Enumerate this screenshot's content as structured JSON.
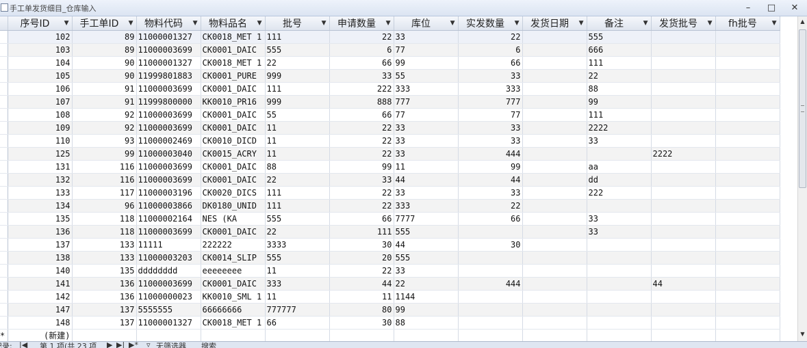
{
  "window": {
    "title": "手工单发货细目_仓库输入"
  },
  "columns": [
    {
      "label": "序号ID",
      "align": "num"
    },
    {
      "label": "手工单ID",
      "align": "num"
    },
    {
      "label": "物料代码",
      "align": "txt"
    },
    {
      "label": "物料品名",
      "align": "txt"
    },
    {
      "label": "批号",
      "align": "txt"
    },
    {
      "label": "申请数量",
      "align": "num"
    },
    {
      "label": "库位",
      "align": "txt"
    },
    {
      "label": "实发数量",
      "align": "num"
    },
    {
      "label": "发货日期",
      "align": "txt"
    },
    {
      "label": "备注",
      "align": "txt"
    },
    {
      "label": "发货批号",
      "align": "txt"
    },
    {
      "label": "fh批号",
      "align": "txt"
    }
  ],
  "rows": [
    [
      "102",
      "89",
      "11000001327",
      "CK0018_MET 1",
      "111",
      "22",
      "33",
      "22",
      "",
      "555",
      "",
      ""
    ],
    [
      "103",
      "89",
      "11000003699",
      "CK0001_DAIC",
      "555",
      "6",
      "77",
      "6",
      "",
      "666",
      "",
      ""
    ],
    [
      "104",
      "90",
      "11000001327",
      "CK0018_MET 1",
      "22",
      "66",
      "99",
      "66",
      "",
      "111",
      "",
      ""
    ],
    [
      "105",
      "90",
      "11999801883",
      "CK0001_PURE",
      "999",
      "33",
      "55",
      "33",
      "",
      "22",
      "",
      ""
    ],
    [
      "106",
      "91",
      "11000003699",
      "CK0001_DAIC",
      "111",
      "222",
      "333",
      "333",
      "",
      "88",
      "",
      ""
    ],
    [
      "107",
      "91",
      "11999800000",
      "KK0010_PR16",
      "999",
      "888",
      "777",
      "777",
      "",
      "99",
      "",
      ""
    ],
    [
      "108",
      "92",
      "11000003699",
      "CK0001_DAIC",
      "55",
      "66",
      "77",
      "77",
      "",
      "111",
      "",
      ""
    ],
    [
      "109",
      "92",
      "11000003699",
      "CK0001_DAIC",
      "11",
      "22",
      "33",
      "33",
      "",
      "2222",
      "",
      ""
    ],
    [
      "110",
      "93",
      "11000002469",
      "CK0010_DICD",
      "11",
      "22",
      "33",
      "33",
      "",
      "33",
      "",
      ""
    ],
    [
      "125",
      "99",
      "11000003040",
      "CK0015_ACRY",
      "11",
      "22",
      "33",
      "444",
      "",
      "",
      "2222",
      ""
    ],
    [
      "131",
      "116",
      "11000003699",
      "CK0001_DAIC",
      "88",
      "99",
      "11",
      "99",
      "",
      "aa",
      "",
      ""
    ],
    [
      "132",
      "116",
      "11000003699",
      "CK0001_DAIC",
      "22",
      "33",
      "44",
      "44",
      "",
      "dd",
      "",
      ""
    ],
    [
      "133",
      "117",
      "11000003196",
      "CK0020_DICS",
      "111",
      "22",
      "33",
      "33",
      "",
      "222",
      "",
      ""
    ],
    [
      "134",
      "96",
      "11000003866",
      "DK0180_UNID",
      "111",
      "22",
      "333",
      "22",
      "",
      "",
      "",
      ""
    ],
    [
      "135",
      "118",
      "11000002164",
      "NES (KA",
      "555",
      "66",
      "7777",
      "66",
      "",
      "33",
      "",
      ""
    ],
    [
      "136",
      "118",
      "11000003699",
      "CK0001_DAIC",
      "22",
      "111",
      "555",
      "",
      "",
      "33",
      "",
      ""
    ],
    [
      "137",
      "133",
      "11111",
      "222222",
      "3333",
      "30",
      "44",
      "30",
      "",
      "",
      "",
      ""
    ],
    [
      "138",
      "133",
      "11000003203",
      "CK0014_SLIP",
      "555",
      "20",
      "555",
      "",
      "",
      "",
      "",
      ""
    ],
    [
      "140",
      "135",
      "dddddddd",
      "eeeeeeee",
      "11",
      "22",
      "33",
      "",
      "",
      "",
      "",
      ""
    ],
    [
      "141",
      "136",
      "11000003699",
      "CK0001_DAIC",
      "333",
      "44",
      "22",
      "444",
      "",
      "",
      "44",
      ""
    ],
    [
      "142",
      "136",
      "11000000023",
      "KK0010_SML 1",
      "11",
      "11",
      "1144",
      "",
      "",
      "",
      "",
      ""
    ],
    [
      "147",
      "137",
      "5555555",
      "66666666",
      "777777",
      "80",
      "99",
      "",
      "",
      "",
      "",
      ""
    ],
    [
      "148",
      "137",
      "11000001327",
      "CK0018_MET 1",
      "66",
      "30",
      "88",
      "",
      "",
      "",
      "",
      ""
    ]
  ],
  "new_row": {
    "marker": "*",
    "label": "(新建)"
  },
  "status": {
    "record_label": "记录:",
    "record_text": "第 1 项(共 23 项",
    "filter_label": "无筛选器",
    "search_label": "搜索"
  },
  "icons": {
    "minimize": "minimize-icon",
    "maximize": "maximize-icon",
    "close": "close-icon",
    "dropdown": "chevron-down-icon"
  }
}
